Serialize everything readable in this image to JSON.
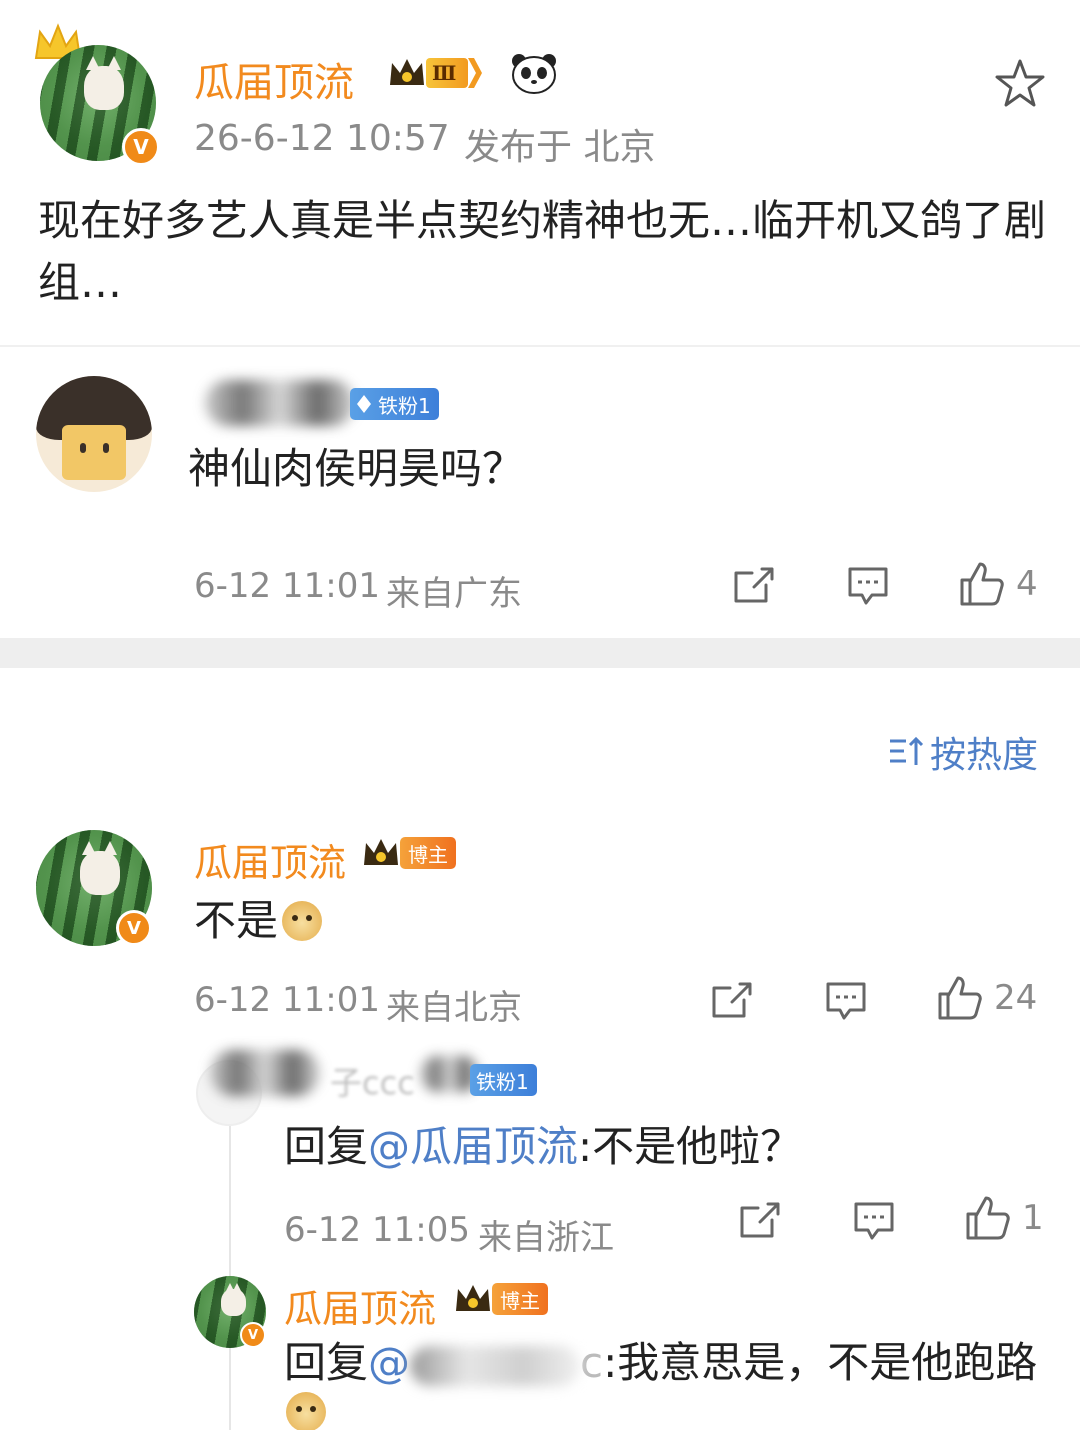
{
  "post": {
    "author": "瓜届顶流",
    "level_badge": "Ⅲ",
    "timestamp": "26-6-12 10:57",
    "location": "发布于 北京",
    "text": "现在好多艺人真是半点契约精神也无…临开机又鸽了剧组…"
  },
  "comment1": {
    "fans_badge": "铁粉1",
    "text": "神仙肉侯明昊吗？",
    "time": "6-12 11:01",
    "location": "来自广东",
    "likes": "4"
  },
  "sort": {
    "label": "按热度"
  },
  "comment2": {
    "author": "瓜届顶流",
    "host_badge": "博主",
    "text": "不是",
    "time": "6-12 11:01",
    "location": "来自北京",
    "likes": "24"
  },
  "reply1": {
    "name_fragment": "子ccc",
    "fans_badge": "铁粉1",
    "prefix": "回复",
    "mention": "@瓜届顶流",
    "text": ":不是他啦？",
    "time": "6-12 11:05",
    "location": "来自浙江",
    "likes": "1"
  },
  "reply2": {
    "author": "瓜届顶流",
    "host_badge": "博主",
    "prefix": "回复",
    "mention_start": "@",
    "mention_end": "c",
    "text": ":我意思是，不是他跑路"
  },
  "colors": {
    "name_orange": "#f28a1e",
    "mention_blue": "#4f7fc7",
    "meta_gray": "#8a8a8a",
    "fans_blue": "#3d7fd9"
  },
  "icons": [
    "star-icon",
    "share-icon",
    "comment-icon",
    "like-icon",
    "sort-icon",
    "crown-icon",
    "panda-icon",
    "doge-emoji"
  ]
}
